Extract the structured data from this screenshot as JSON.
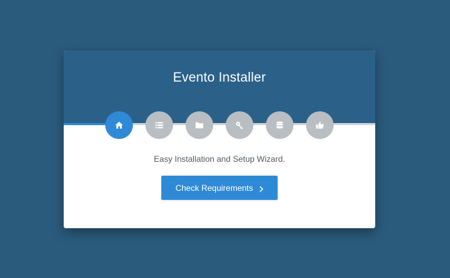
{
  "installer": {
    "title": "Evento Installer",
    "subtitle": "Easy Installation and Setup Wizard.",
    "progress_fraction": 0.15,
    "steps": [
      {
        "icon": "home-icon",
        "active": true
      },
      {
        "icon": "list-icon",
        "active": false
      },
      {
        "icon": "folder-icon",
        "active": false
      },
      {
        "icon": "key-icon",
        "active": false
      },
      {
        "icon": "database-icon",
        "active": false
      },
      {
        "icon": "thumbs-up-icon",
        "active": false
      }
    ],
    "primary_button": {
      "label": "Check Requirements",
      "icon": "chevron-right-icon"
    }
  },
  "colors": {
    "background": "#2a5a7c",
    "header": "#2b6189",
    "accent": "#2e8ad6",
    "inactive_step": "#b9bec3"
  }
}
